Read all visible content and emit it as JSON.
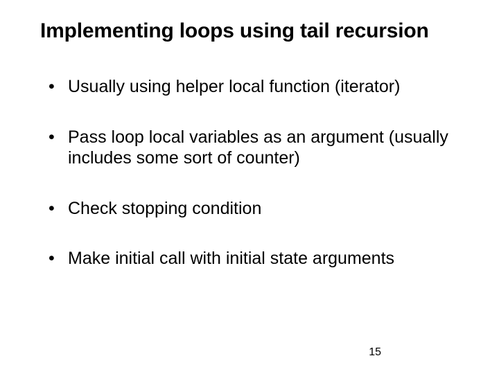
{
  "slide": {
    "title": "Implementing loops using tail recursion",
    "bullets": [
      "Usually using helper local function (iterator)",
      "Pass loop local variables as an argument (usually includes some sort of counter)",
      "Check stopping condition",
      "Make initial call with initial state arguments"
    ],
    "page_number": "15"
  }
}
